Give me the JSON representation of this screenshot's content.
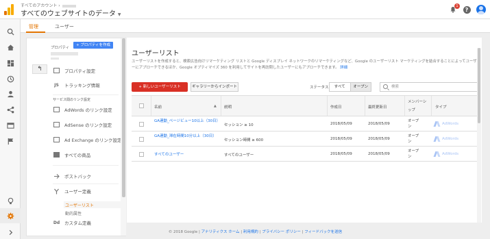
{
  "topbar": {
    "breadcrumb": "すべてのアカウント ›",
    "account_title": "すべてのウェブサイトのデータ",
    "notification_count": "1",
    "help_label": "?"
  },
  "rail": {
    "icons": [
      "search-icon",
      "home-icon",
      "dashboard-icon",
      "clock-icon",
      "person-icon",
      "share-icon",
      "report-icon",
      "flag-icon",
      "lightbulb-icon",
      "gear-icon",
      "chevron-right-icon"
    ]
  },
  "tabs": {
    "admin": "管理",
    "user": "ユーザー"
  },
  "panel": {
    "property_label": "プロパティ",
    "create_property": "+ プロパティを作成",
    "back_glyph": "↰",
    "items": [
      {
        "label": "プロパティ設定",
        "icon_text": ""
      },
      {
        "label": "トラッキング情報",
        "icon_text": "JS"
      }
    ],
    "section_heading": "サービス間のリンク設定",
    "link_items": [
      {
        "label": "AdWords のリンク設定"
      },
      {
        "label": "AdSense のリンク設定"
      },
      {
        "label": "Ad Exchange のリンク設定"
      },
      {
        "label": "すべての商品"
      }
    ],
    "postback": "ポストバック",
    "user_definition": "ユーザー定義",
    "user_list": "ユーザーリスト",
    "dynamic_attrs": "動的属性",
    "custom_def_partial": "カスタム定義"
  },
  "main": {
    "title": "ユーザーリスト",
    "description": "ユーザーリストを作成すると、検索広告向けリマーケティング リストと Google ディスプレイ ネットワークのリマーケティングなど、Google のユーザーリスト マーケティングを結合することによってユーザーにアプローチできるほか、Google オプティマイズ 360 を利用してサイトを再訪問したユーザーにもアプローチできます。",
    "details_link": "詳細",
    "new_list_button": "+ 新しいユーザーリスト",
    "import_button": "ギャラリーからインポート",
    "status_label": "ステータス",
    "status_all": "すべて",
    "status_open": "オープン",
    "search_placeholder": "検索",
    "table": {
      "headers": {
        "name": "名前",
        "description": "説明",
        "created": "作成日",
        "modified": "最終更新日",
        "membership": "メンバーシップ",
        "type": "タイプ"
      },
      "rows": [
        {
          "name": "GA連動_ページビュー10以上（30日）",
          "description": "セッション ≥ 10",
          "created": "2018/05/09",
          "modified": "2018/05/09",
          "membership": "オープン",
          "type": "AdWords"
        },
        {
          "name": "GA連動_滞在時間10分以上（30日）",
          "description": "セッション時間 ≥ 600",
          "created": "2018/05/09",
          "modified": "2018/05/09",
          "membership": "オープン",
          "type": "AdWords"
        },
        {
          "name": "すべてのユーザー",
          "description": "すべてのユーザー",
          "created": "2018/05/09",
          "modified": "2018/05/09",
          "membership": "オープン",
          "type": "AdWords"
        }
      ]
    }
  },
  "footer": {
    "copyright": "© 2018 Google |",
    "links": [
      "アナリティクス ホーム",
      "利用規約",
      "プライバシー ポリシー",
      "フィードバックを送信"
    ]
  },
  "colors": {
    "accent": "#e37400",
    "link": "#1a73e8",
    "danger": "#d93025",
    "primary": "#4285f4"
  }
}
